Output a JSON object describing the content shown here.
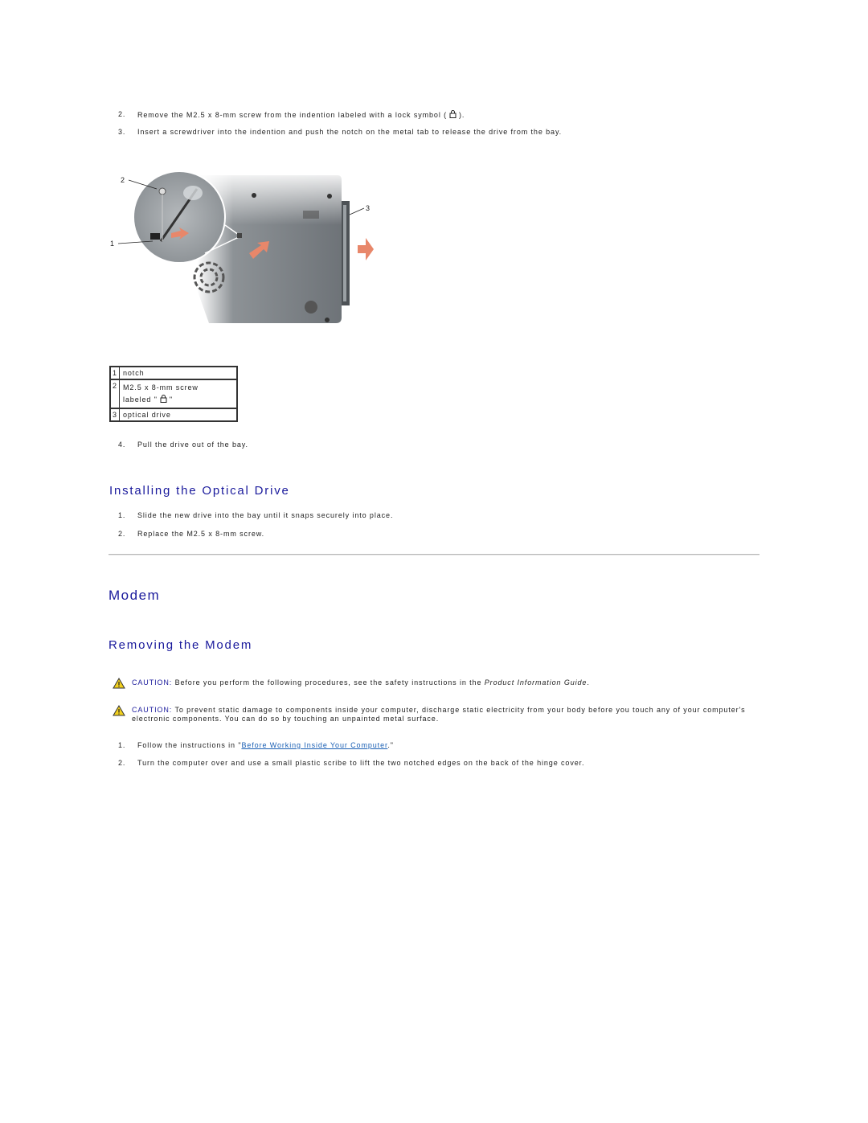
{
  "steps_removal": [
    {
      "num": "2.",
      "text_before": "Remove the M2.5 x 8-mm screw from the indention labeled with a lock symbol (",
      "icon": "lock-icon",
      "text_after": ")."
    },
    {
      "num": "3.",
      "text": "Insert a screwdriver into the indention and push the notch on the metal tab to release the drive from the bay."
    }
  ],
  "figure": {
    "callouts": [
      "1",
      "2",
      "3"
    ],
    "description": "Optical drive removal illustration"
  },
  "legend": [
    {
      "num": "1",
      "label": "notch"
    },
    {
      "num": "2",
      "label_line1": "M2.5 x 8-mm screw",
      "label_line2_before": "labeled \"",
      "icon": "lock-icon",
      "label_line2_after": "\""
    },
    {
      "num": "3",
      "label": "optical drive"
    }
  ],
  "step4": {
    "num": "4.",
    "text": "Pull the drive out of the bay."
  },
  "installing": {
    "heading": "Installing the Optical Drive",
    "steps": [
      {
        "num": "1.",
        "text": "Slide the new drive into the bay until it snaps securely into place."
      },
      {
        "num": "2.",
        "text": "Replace the M2.5 x 8-mm screw."
      }
    ]
  },
  "modem": {
    "heading": "Modem",
    "subheading": "Removing the Modem",
    "cautions": [
      {
        "label": "CAUTION:",
        "text_before": " Before you perform the following procedures, see the safety instructions in the ",
        "italic": "Product Information Guide",
        "text_after": "."
      },
      {
        "label": "CAUTION:",
        "text": " To prevent static damage to components inside your computer, discharge static electricity from your body before you touch any of your computer's electronic components. You can do so by touching an unpainted metal surface."
      }
    ],
    "steps": [
      {
        "num": "1.",
        "text_before": "Follow the instructions in \"",
        "link": "Before Working Inside Your Computer",
        "text_after": ".\""
      },
      {
        "num": "2.",
        "text": "Turn the computer over and use a small plastic scribe to lift the two notched edges on the back of the hinge cover."
      }
    ]
  }
}
